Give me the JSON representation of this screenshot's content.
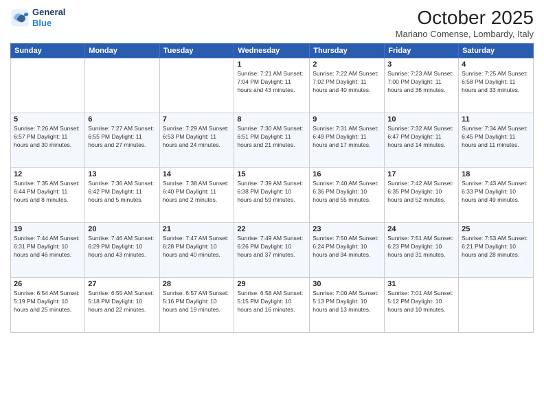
{
  "header": {
    "logo_line1": "General",
    "logo_line2": "Blue",
    "month_title": "October 2025",
    "location": "Mariano Comense, Lombardy, Italy"
  },
  "days_of_week": [
    "Sunday",
    "Monday",
    "Tuesday",
    "Wednesday",
    "Thursday",
    "Friday",
    "Saturday"
  ],
  "weeks": [
    [
      {
        "day": "",
        "info": ""
      },
      {
        "day": "",
        "info": ""
      },
      {
        "day": "",
        "info": ""
      },
      {
        "day": "1",
        "info": "Sunrise: 7:21 AM\nSunset: 7:04 PM\nDaylight: 11 hours and 43 minutes."
      },
      {
        "day": "2",
        "info": "Sunrise: 7:22 AM\nSunset: 7:02 PM\nDaylight: 11 hours and 40 minutes."
      },
      {
        "day": "3",
        "info": "Sunrise: 7:23 AM\nSunset: 7:00 PM\nDaylight: 11 hours and 36 minutes."
      },
      {
        "day": "4",
        "info": "Sunrise: 7:25 AM\nSunset: 6:58 PM\nDaylight: 11 hours and 33 minutes."
      }
    ],
    [
      {
        "day": "5",
        "info": "Sunrise: 7:26 AM\nSunset: 6:57 PM\nDaylight: 11 hours and 30 minutes."
      },
      {
        "day": "6",
        "info": "Sunrise: 7:27 AM\nSunset: 6:55 PM\nDaylight: 11 hours and 27 minutes."
      },
      {
        "day": "7",
        "info": "Sunrise: 7:29 AM\nSunset: 6:53 PM\nDaylight: 11 hours and 24 minutes."
      },
      {
        "day": "8",
        "info": "Sunrise: 7:30 AM\nSunset: 6:51 PM\nDaylight: 11 hours and 21 minutes."
      },
      {
        "day": "9",
        "info": "Sunrise: 7:31 AM\nSunset: 6:49 PM\nDaylight: 11 hours and 17 minutes."
      },
      {
        "day": "10",
        "info": "Sunrise: 7:32 AM\nSunset: 6:47 PM\nDaylight: 11 hours and 14 minutes."
      },
      {
        "day": "11",
        "info": "Sunrise: 7:34 AM\nSunset: 6:45 PM\nDaylight: 11 hours and 11 minutes."
      }
    ],
    [
      {
        "day": "12",
        "info": "Sunrise: 7:35 AM\nSunset: 6:44 PM\nDaylight: 11 hours and 8 minutes."
      },
      {
        "day": "13",
        "info": "Sunrise: 7:36 AM\nSunset: 6:42 PM\nDaylight: 11 hours and 5 minutes."
      },
      {
        "day": "14",
        "info": "Sunrise: 7:38 AM\nSunset: 6:40 PM\nDaylight: 11 hours and 2 minutes."
      },
      {
        "day": "15",
        "info": "Sunrise: 7:39 AM\nSunset: 6:38 PM\nDaylight: 10 hours and 59 minutes."
      },
      {
        "day": "16",
        "info": "Sunrise: 7:40 AM\nSunset: 6:36 PM\nDaylight: 10 hours and 55 minutes."
      },
      {
        "day": "17",
        "info": "Sunrise: 7:42 AM\nSunset: 6:35 PM\nDaylight: 10 hours and 52 minutes."
      },
      {
        "day": "18",
        "info": "Sunrise: 7:43 AM\nSunset: 6:33 PM\nDaylight: 10 hours and 49 minutes."
      }
    ],
    [
      {
        "day": "19",
        "info": "Sunrise: 7:44 AM\nSunset: 6:31 PM\nDaylight: 10 hours and 46 minutes."
      },
      {
        "day": "20",
        "info": "Sunrise: 7:46 AM\nSunset: 6:29 PM\nDaylight: 10 hours and 43 minutes."
      },
      {
        "day": "21",
        "info": "Sunrise: 7:47 AM\nSunset: 6:28 PM\nDaylight: 10 hours and 40 minutes."
      },
      {
        "day": "22",
        "info": "Sunrise: 7:49 AM\nSunset: 6:26 PM\nDaylight: 10 hours and 37 minutes."
      },
      {
        "day": "23",
        "info": "Sunrise: 7:50 AM\nSunset: 6:24 PM\nDaylight: 10 hours and 34 minutes."
      },
      {
        "day": "24",
        "info": "Sunrise: 7:51 AM\nSunset: 6:23 PM\nDaylight: 10 hours and 31 minutes."
      },
      {
        "day": "25",
        "info": "Sunrise: 7:53 AM\nSunset: 6:21 PM\nDaylight: 10 hours and 28 minutes."
      }
    ],
    [
      {
        "day": "26",
        "info": "Sunrise: 6:54 AM\nSunset: 5:19 PM\nDaylight: 10 hours and 25 minutes."
      },
      {
        "day": "27",
        "info": "Sunrise: 6:55 AM\nSunset: 5:18 PM\nDaylight: 10 hours and 22 minutes."
      },
      {
        "day": "28",
        "info": "Sunrise: 6:57 AM\nSunset: 5:16 PM\nDaylight: 10 hours and 19 minutes."
      },
      {
        "day": "29",
        "info": "Sunrise: 6:58 AM\nSunset: 5:15 PM\nDaylight: 10 hours and 16 minutes."
      },
      {
        "day": "30",
        "info": "Sunrise: 7:00 AM\nSunset: 5:13 PM\nDaylight: 10 hours and 13 minutes."
      },
      {
        "day": "31",
        "info": "Sunrise: 7:01 AM\nSunset: 5:12 PM\nDaylight: 10 hours and 10 minutes."
      },
      {
        "day": "",
        "info": ""
      }
    ]
  ]
}
